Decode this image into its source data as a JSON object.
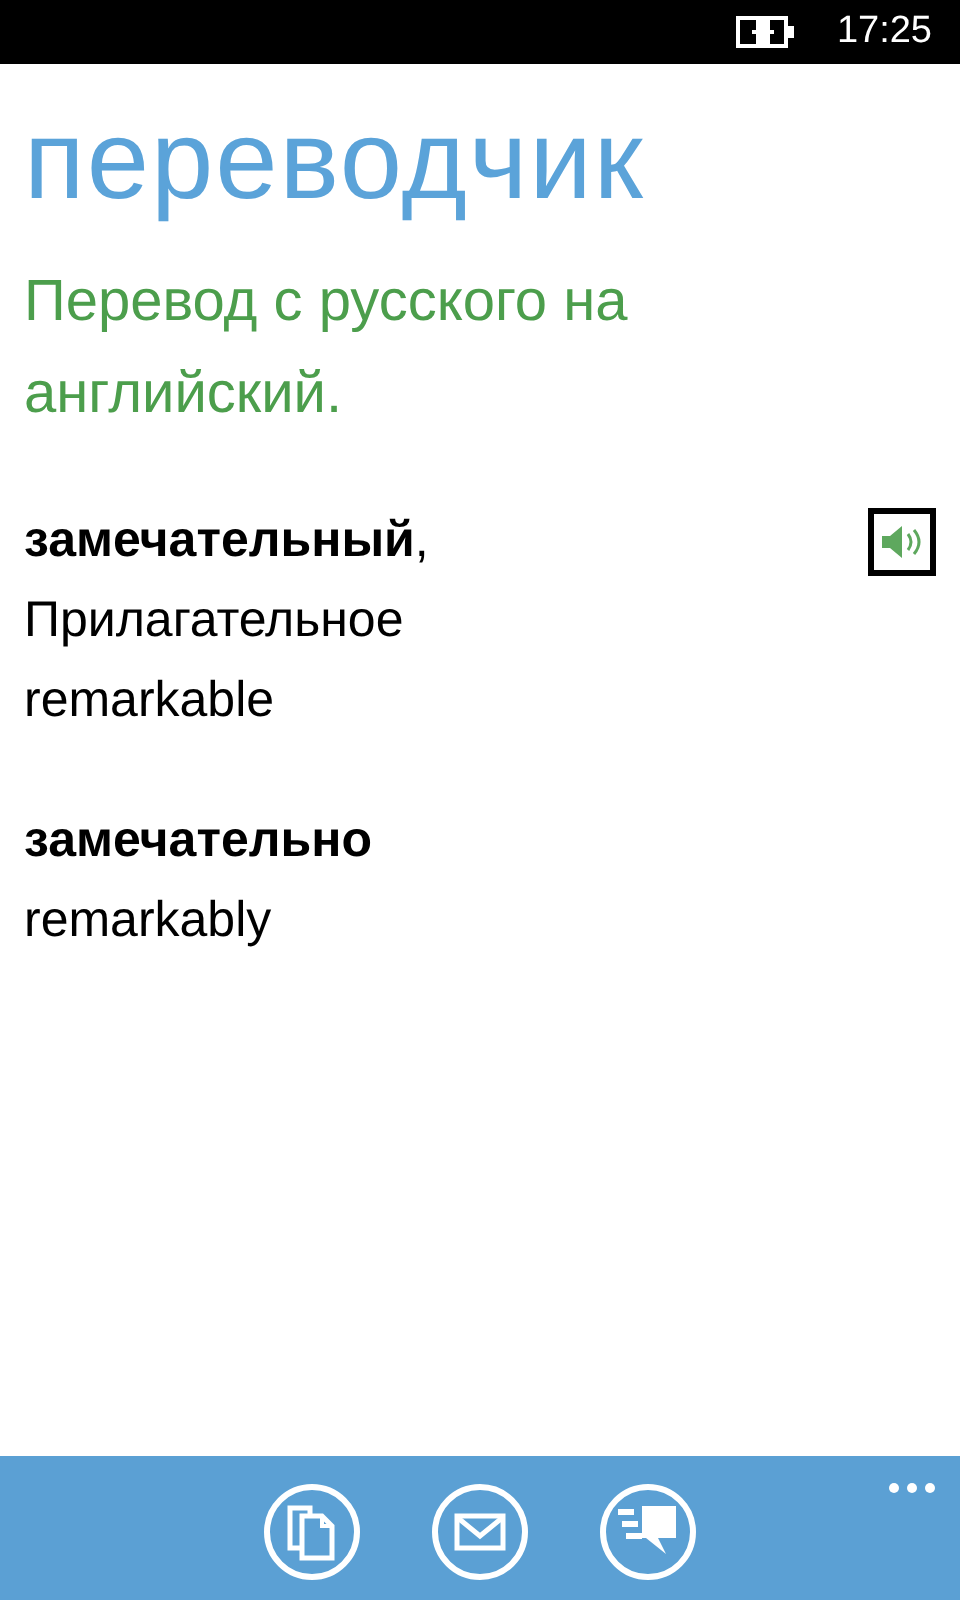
{
  "status_bar": {
    "charging": true,
    "time": "17:25"
  },
  "app_title": "переводчик",
  "subtitle": "Перевод с русского на английский.",
  "entries": [
    {
      "headword": "**замечательный**,",
      "part_of_speech": "Прилагательное",
      "translation": "remarkable",
      "audio": true
    },
    {
      "headword": "**замечательно**",
      "translation": "remarkably",
      "audio": false
    }
  ],
  "app_bar": {
    "buttons": [
      {
        "kind": "copy"
      },
      {
        "kind": "mail"
      },
      {
        "kind": "speak"
      }
    ]
  }
}
